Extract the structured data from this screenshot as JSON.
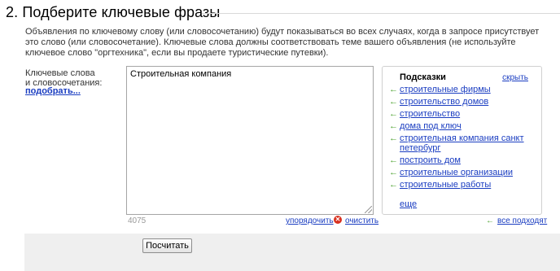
{
  "section": {
    "title": "2. Подберите ключевые фразы",
    "description": "Объявления по ключевому слову (или словосочетанию) будут показываться во всех случаях, когда в запросе присутствует это слово (или словосочетание). Ключевые слова должны соответствовать теме вашего объявления (не используйте ключевое слово \"оргтехника\", если вы продаете туристические путевки)."
  },
  "keywords": {
    "label_line1": "Ключевые слова",
    "label_line2": "и словосочетания:",
    "pick_link": "подобрать...",
    "textarea_value": "Строительная компания",
    "char_count": "4075",
    "sort_link": "упорядочить",
    "clear_link": "очистить"
  },
  "hints": {
    "title": "Подсказки",
    "hide_link": "скрыть",
    "items": [
      "строительные фирмы",
      "строительство домов",
      "строительство",
      "дома под ключ",
      "строительная компания санкт петербург",
      "построить дом",
      "строительные организации",
      "строительные работы"
    ],
    "more_link": "еще",
    "all_fits_link": "все подходят"
  },
  "actions": {
    "submit_label": "Посчитать"
  },
  "colors": {
    "link": "#1a3dc1",
    "arrow": "#4aa02c",
    "clear_icon": "#d8301f",
    "bottom_bar": "#efefef"
  },
  "icons": {
    "hint_arrow": "left-arrow-icon",
    "clear": "clear-x-icon"
  }
}
